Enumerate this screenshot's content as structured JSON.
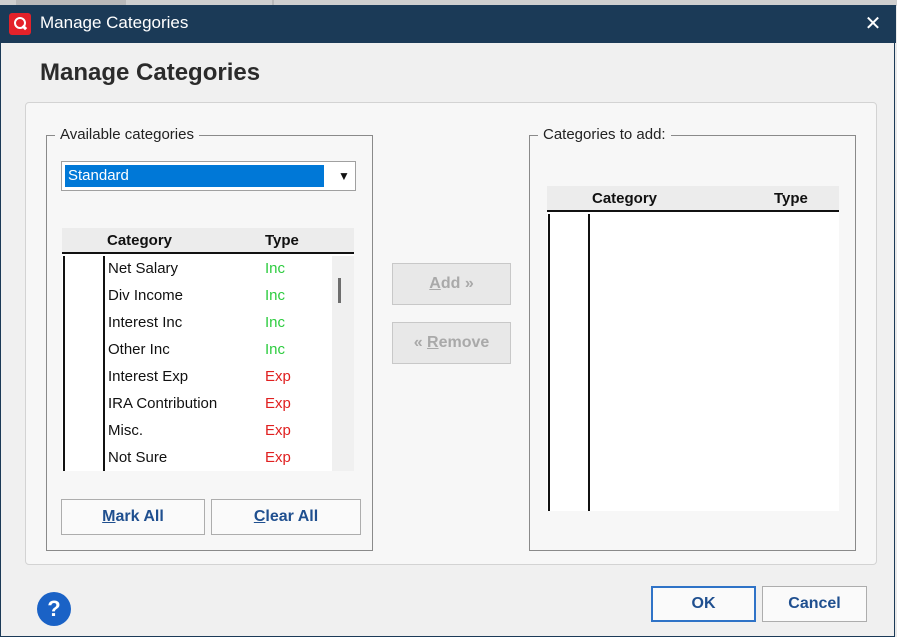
{
  "window": {
    "title": "Manage Categories",
    "close_glyph": "✕",
    "icon": "app-logo-icon"
  },
  "heading": "Manage Categories",
  "available": {
    "legend": "Available categories",
    "combo": {
      "selected": "Standard",
      "arrow_glyph": "▼"
    },
    "columns": {
      "category": "Category",
      "type": "Type"
    },
    "rows": [
      {
        "category": "Net Salary",
        "type": "Inc"
      },
      {
        "category": "Div Income",
        "type": "Inc"
      },
      {
        "category": "Interest Inc",
        "type": "Inc"
      },
      {
        "category": "Other Inc",
        "type": "Inc"
      },
      {
        "category": "Interest Exp",
        "type": "Exp"
      },
      {
        "category": "IRA Contribution",
        "type": "Exp"
      },
      {
        "category": "Misc.",
        "type": "Exp"
      },
      {
        "category": "Not Sure",
        "type": "Exp"
      }
    ],
    "mark_all": {
      "mnemonic": "M",
      "rest": "ark All"
    },
    "clear_all": {
      "mnemonic": "C",
      "rest": "lear All"
    }
  },
  "actions": {
    "add": {
      "mnemonic": "A",
      "rest": "dd »"
    },
    "remove": {
      "prefix": "« ",
      "mnemonic": "R",
      "rest": "emove"
    }
  },
  "to_add": {
    "legend": "Categories to add:",
    "columns": {
      "category": "Category",
      "type": "Type"
    },
    "rows": []
  },
  "footer": {
    "help_glyph": "?",
    "ok": "OK",
    "cancel": "Cancel"
  },
  "colors": {
    "titlebar": "#1b3a57",
    "selection": "#0078d7",
    "inc": "#2ecc40",
    "exp": "#e02020",
    "link_button": "#1f4f8f",
    "help": "#1a62c6"
  }
}
